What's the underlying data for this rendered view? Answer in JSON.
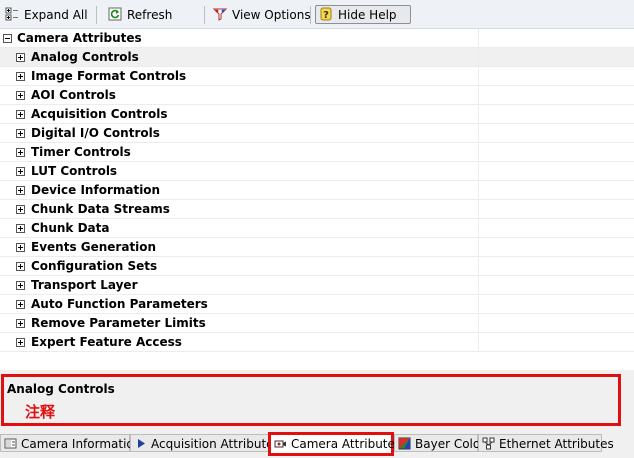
{
  "toolbar": {
    "expand_all": "Expand All",
    "refresh": "Refresh",
    "view_options": "View Options",
    "hide_help": "Hide Help"
  },
  "tree": {
    "root": "Camera Attributes",
    "items": [
      "Analog Controls",
      "Image Format Controls",
      "AOI Controls",
      "Acquisition Controls",
      "Digital I/O Controls",
      "Timer Controls",
      "LUT Controls",
      "Device Information",
      "Chunk Data Streams",
      "Chunk Data",
      "Events Generation",
      "Configuration Sets",
      "Transport Layer",
      "Auto Function Parameters",
      "Remove Parameter Limits",
      "Expert Feature Access"
    ]
  },
  "help": {
    "title": "Analog Controls",
    "text": "注释"
  },
  "tabs": [
    {
      "label": "Camera Information",
      "icon": "camera-info-icon"
    },
    {
      "label": "Acquisition Attributes",
      "icon": "play-arrow-icon"
    },
    {
      "label": "Camera Attributes",
      "icon": "camera-icon"
    },
    {
      "label": "Bayer Color",
      "icon": "color-square-icon"
    },
    {
      "label": "Ethernet Attributes",
      "icon": "network-icon"
    }
  ],
  "colors": {
    "highlight": "#e01010",
    "toolbar_bg": "#eef1f5"
  }
}
